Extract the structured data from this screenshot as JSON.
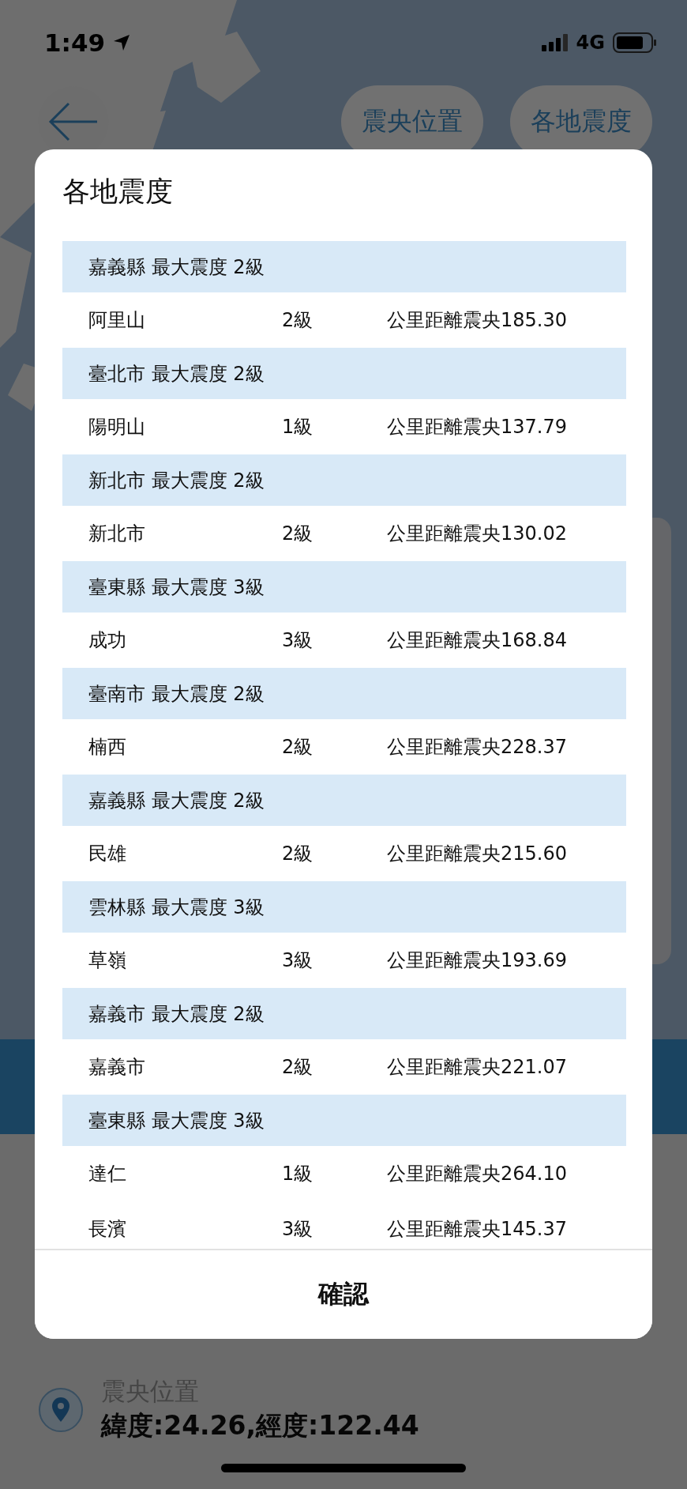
{
  "status_bar": {
    "time": "1:49",
    "network": "4G"
  },
  "header": {
    "buttons": [
      {
        "label": "震央位置"
      },
      {
        "label": "各地震度"
      }
    ]
  },
  "dialog": {
    "title": "各地震度",
    "groups": [
      {
        "header": "嘉義縣 最大震度 2級",
        "stations": [
          {
            "name": "阿里山",
            "intensity": "2級",
            "distance": "公里距離震央185.30"
          }
        ]
      },
      {
        "header": "臺北市 最大震度 2級",
        "stations": [
          {
            "name": "陽明山",
            "intensity": "1級",
            "distance": "公里距離震央137.79"
          }
        ]
      },
      {
        "header": "新北市 最大震度 2級",
        "stations": [
          {
            "name": "新北市",
            "intensity": "2級",
            "distance": "公里距離震央130.02"
          }
        ]
      },
      {
        "header": "臺東縣 最大震度 3級",
        "stations": [
          {
            "name": "成功",
            "intensity": "3級",
            "distance": "公里距離震央168.84"
          }
        ]
      },
      {
        "header": "臺南市 最大震度 2級",
        "stations": [
          {
            "name": "楠西",
            "intensity": "2級",
            "distance": "公里距離震央228.37"
          }
        ]
      },
      {
        "header": "嘉義縣 最大震度 2級",
        "stations": [
          {
            "name": "民雄",
            "intensity": "2級",
            "distance": "公里距離震央215.60"
          }
        ]
      },
      {
        "header": "雲林縣 最大震度 3級",
        "stations": [
          {
            "name": "草嶺",
            "intensity": "3級",
            "distance": "公里距離震央193.69"
          }
        ]
      },
      {
        "header": "嘉義市 最大震度 2級",
        "stations": [
          {
            "name": "嘉義市",
            "intensity": "2級",
            "distance": "公里距離震央221.07"
          }
        ]
      },
      {
        "header": "臺東縣 最大震度 3級",
        "stations": [
          {
            "name": "達仁",
            "intensity": "1級",
            "distance": "公里距離震央264.10"
          },
          {
            "name": "長濱",
            "intensity": "3級",
            "distance": "公里距離震央145.37"
          }
        ]
      }
    ],
    "confirm": "確認"
  },
  "epicenter": {
    "label": "震央位置",
    "coords": "緯度:24.26,經度:122.44"
  }
}
